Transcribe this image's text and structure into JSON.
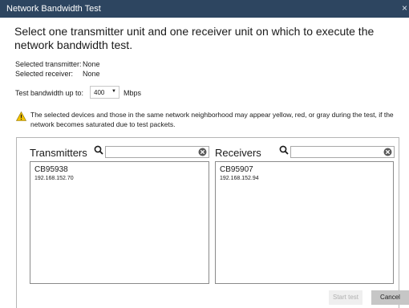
{
  "window": {
    "title": "Network Bandwidth Test",
    "close_glyph": "×"
  },
  "heading": "Select one transmitter unit and one receiver unit on which to execute the network bandwidth test.",
  "selection": {
    "transmitter_label": "Selected transmitter:",
    "transmitter_value": "None",
    "receiver_label": "Selected receiver:",
    "receiver_value": "None"
  },
  "bandwidth": {
    "label": "Test bandwidth up to:",
    "value": "400",
    "unit": "Mbps"
  },
  "warning": {
    "icon": "warning-triangle-icon",
    "text": "The selected devices and those in the same network neighborhood may appear yellow, red, or gray during the test, if the network becomes saturated due to test packets."
  },
  "transmitters": {
    "title": "Transmitters",
    "search_value": "",
    "items": [
      {
        "name": "CB95938",
        "ip": "192.168.152.70"
      }
    ]
  },
  "receivers": {
    "title": "Receivers",
    "search_value": "",
    "items": [
      {
        "name": "CB95907",
        "ip": "192.168.152.94"
      }
    ]
  },
  "buttons": {
    "start": "Start test",
    "cancel": "Cancel"
  },
  "colors": {
    "titlebar": "#2d4560",
    "warning": "#f2c200",
    "disabled_button": "#efefef",
    "cancel_button": "#c6c6c6"
  }
}
